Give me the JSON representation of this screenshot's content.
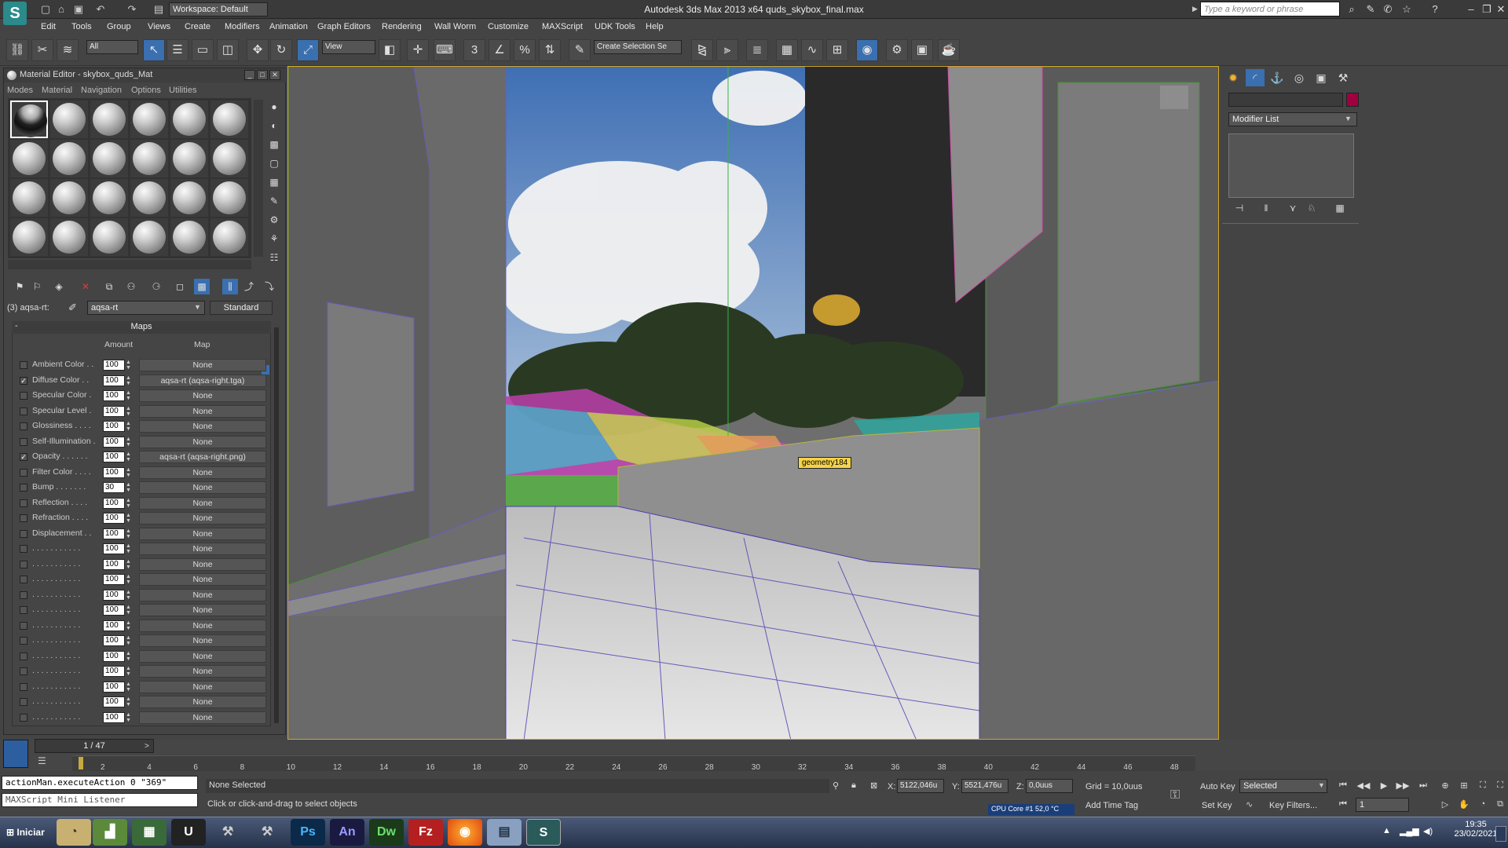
{
  "app": {
    "title": "Autodesk 3ds Max  2013 x64     quds_skybox_final.max",
    "workspace": "Workspace: Default",
    "search_placeholder": "Type a keyword or phrase"
  },
  "menu": [
    "Edit",
    "Tools",
    "Group",
    "Views",
    "Create",
    "Modifiers",
    "Animation",
    "Graph Editors",
    "Rendering",
    "Wall Worm",
    "Customize",
    "MAXScript",
    "UDK Tools",
    "Help"
  ],
  "toolbar": {
    "filter_select": "All",
    "view_select": "View",
    "snap_labels": [
      "3",
      "%"
    ],
    "selection_set": "Create Selection Se"
  },
  "material_editor": {
    "title": "Material Editor - skybox_quds_Mat",
    "menu": [
      "Modes",
      "Material",
      "Navigation",
      "Options",
      "Utilities"
    ],
    "slot_label": "(3) aqsa-rt:",
    "material_name": "aqsa-rt",
    "material_type": "Standard",
    "maps_header": "Maps",
    "col_amount": "Amount",
    "col_map": "Map",
    "maps": [
      {
        "label": "Ambient Color . .",
        "checked": false,
        "amount": "100",
        "map": "None"
      },
      {
        "label": "Diffuse Color . .",
        "checked": true,
        "amount": "100",
        "map": "aqsa-rt (aqsa-right.tga)"
      },
      {
        "label": "Specular Color .",
        "checked": false,
        "amount": "100",
        "map": "None"
      },
      {
        "label": "Specular Level .",
        "checked": false,
        "amount": "100",
        "map": "None"
      },
      {
        "label": "Glossiness . . . .",
        "checked": false,
        "amount": "100",
        "map": "None"
      },
      {
        "label": "Self-Illumination .",
        "checked": false,
        "amount": "100",
        "map": "None"
      },
      {
        "label": "Opacity . . . . . .",
        "checked": true,
        "amount": "100",
        "map": "aqsa-rt (aqsa-right.png)"
      },
      {
        "label": "Filter Color . . . .",
        "checked": false,
        "amount": "100",
        "map": "None"
      },
      {
        "label": "Bump . . . . . . .",
        "checked": false,
        "amount": "30",
        "map": "None"
      },
      {
        "label": "Reflection . . . .",
        "checked": false,
        "amount": "100",
        "map": "None"
      },
      {
        "label": "Refraction . . . .",
        "checked": false,
        "amount": "100",
        "map": "None"
      },
      {
        "label": "Displacement . .",
        "checked": false,
        "amount": "100",
        "map": "None"
      },
      {
        "label": ". . . . . . . . . . .",
        "checked": false,
        "amount": "100",
        "map": "None"
      },
      {
        "label": ". . . . . . . . . . .",
        "checked": false,
        "amount": "100",
        "map": "None"
      },
      {
        "label": ". . . . . . . . . . .",
        "checked": false,
        "amount": "100",
        "map": "None"
      },
      {
        "label": ". . . . . . . . . . .",
        "checked": false,
        "amount": "100",
        "map": "None"
      },
      {
        "label": ". . . . . . . . . . .",
        "checked": false,
        "amount": "100",
        "map": "None"
      },
      {
        "label": ". . . . . . . . . . .",
        "checked": false,
        "amount": "100",
        "map": "None"
      },
      {
        "label": ". . . . . . . . . . .",
        "checked": false,
        "amount": "100",
        "map": "None"
      },
      {
        "label": ". . . . . . . . . . .",
        "checked": false,
        "amount": "100",
        "map": "None"
      },
      {
        "label": ". . . . . . . . . . .",
        "checked": false,
        "amount": "100",
        "map": "None"
      },
      {
        "label": ". . . . . . . . . . .",
        "checked": false,
        "amount": "100",
        "map": "None"
      },
      {
        "label": ". . . . . . . . . . .",
        "checked": false,
        "amount": "100",
        "map": "None"
      },
      {
        "label": ". . . . . . . . . . .",
        "checked": false,
        "amount": "100",
        "map": "None"
      }
    ]
  },
  "viewport": {
    "object_label": "geometry184"
  },
  "command_panel": {
    "modifier_list": "Modifier List"
  },
  "timeline": {
    "slider": "1 / 47",
    "ticks": [
      "2",
      "4",
      "6",
      "8",
      "10",
      "12",
      "14",
      "16",
      "18",
      "20",
      "22",
      "24",
      "26",
      "28",
      "30",
      "32",
      "34",
      "36",
      "38",
      "40",
      "42",
      "44",
      "46",
      "48"
    ]
  },
  "status": {
    "maxscript_line1": "actionMan.executeAction 0 \"369\"",
    "maxscript_line2": "MAXScript Mini Listener",
    "selection": "None Selected",
    "prompt": "Click or click-and-drag to select objects",
    "x_label": "X:",
    "x_value": "5122,046u",
    "y_label": "Y:",
    "y_value": "5521,476u",
    "z_label": "Z:",
    "z_value": "0,0uus",
    "grid": "Grid = 10,0uus",
    "add_time_tag": "Add Time Tag",
    "cpu": "CPU Core #1     52,0 °C",
    "auto_key": "Auto Key",
    "set_key": "Set Key",
    "key_mode": "Selected",
    "key_filters": "Key Filters...",
    "frame": "1"
  },
  "taskbar": {
    "start": "Iniciar",
    "apps": [
      "Ps",
      "An",
      "Dw",
      "Fz"
    ],
    "time": "19:35",
    "date": "23/02/2021"
  },
  "colors": {
    "accent": "#3a6fb0",
    "viewport_border": "#d4a82a",
    "label_bg": "#f5d34a",
    "object_color": "#a00040"
  }
}
